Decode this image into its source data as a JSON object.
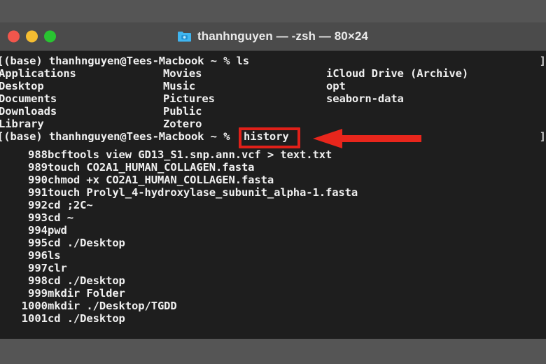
{
  "window": {
    "title": "thanhnguyen — -zsh — 80×24",
    "icon": "folder-icon",
    "traffic_lights": {
      "close_label": "close",
      "minimize_label": "minimize",
      "maximize_label": "maximize",
      "close_color": "#f2564c",
      "minimize_color": "#f5bd31",
      "maximize_color": "#29c431"
    },
    "background_color": "#1e1e1e",
    "chrome_color": "#4b4b4b",
    "page_background": "#555555"
  },
  "terminal": {
    "prompt_ls": "[(base) thanhnguyen@Tees-Macbook ~ % ls",
    "prompt_history_prefix": "[(base) thanhnguyen@Tees-Macbook ~ % ",
    "prompt_history_command": "history",
    "ls_columns": [
      [
        "Applications",
        "Desktop",
        "Documents",
        "Downloads",
        "Library"
      ],
      [
        "Movies",
        "Music",
        "Pictures",
        "Public",
        "Zotero"
      ],
      [
        "iCloud Drive (Archive)",
        "opt",
        "seaborn-data"
      ]
    ],
    "wrap_markers": [
      "]",
      "]"
    ],
    "history": [
      {
        "num": "988",
        "cmd": "bcftools view GD13_S1.snp.ann.vcf > text.txt"
      },
      {
        "num": "989",
        "cmd": "touch CO2A1_HUMAN_COLLAGEN.fasta"
      },
      {
        "num": "990",
        "cmd": "chmod +x CO2A1_HUMAN_COLLAGEN.fasta"
      },
      {
        "num": "991",
        "cmd": "touch Prolyl_4-hydroxylase_subunit_alpha-1.fasta"
      },
      {
        "num": "992",
        "cmd": "cd ;2C~"
      },
      {
        "num": "993",
        "cmd": "cd ~"
      },
      {
        "num": "994",
        "cmd": "pwd"
      },
      {
        "num": "995",
        "cmd": "cd ./Desktop"
      },
      {
        "num": "996",
        "cmd": "ls"
      },
      {
        "num": "997",
        "cmd": "clr"
      },
      {
        "num": "998",
        "cmd": "cd ./Desktop"
      },
      {
        "num": "999",
        "cmd": "mkdir Folder"
      },
      {
        "num": "1000",
        "cmd": "mkdir ./Desktop/TGDD"
      },
      {
        "num": "1001",
        "cmd": "cd ./Desktop"
      }
    ]
  },
  "annotation": {
    "highlight_target": "history",
    "highlight_color": "#e02019",
    "arrow_direction": "left",
    "arrow_color": "#e8261c"
  }
}
